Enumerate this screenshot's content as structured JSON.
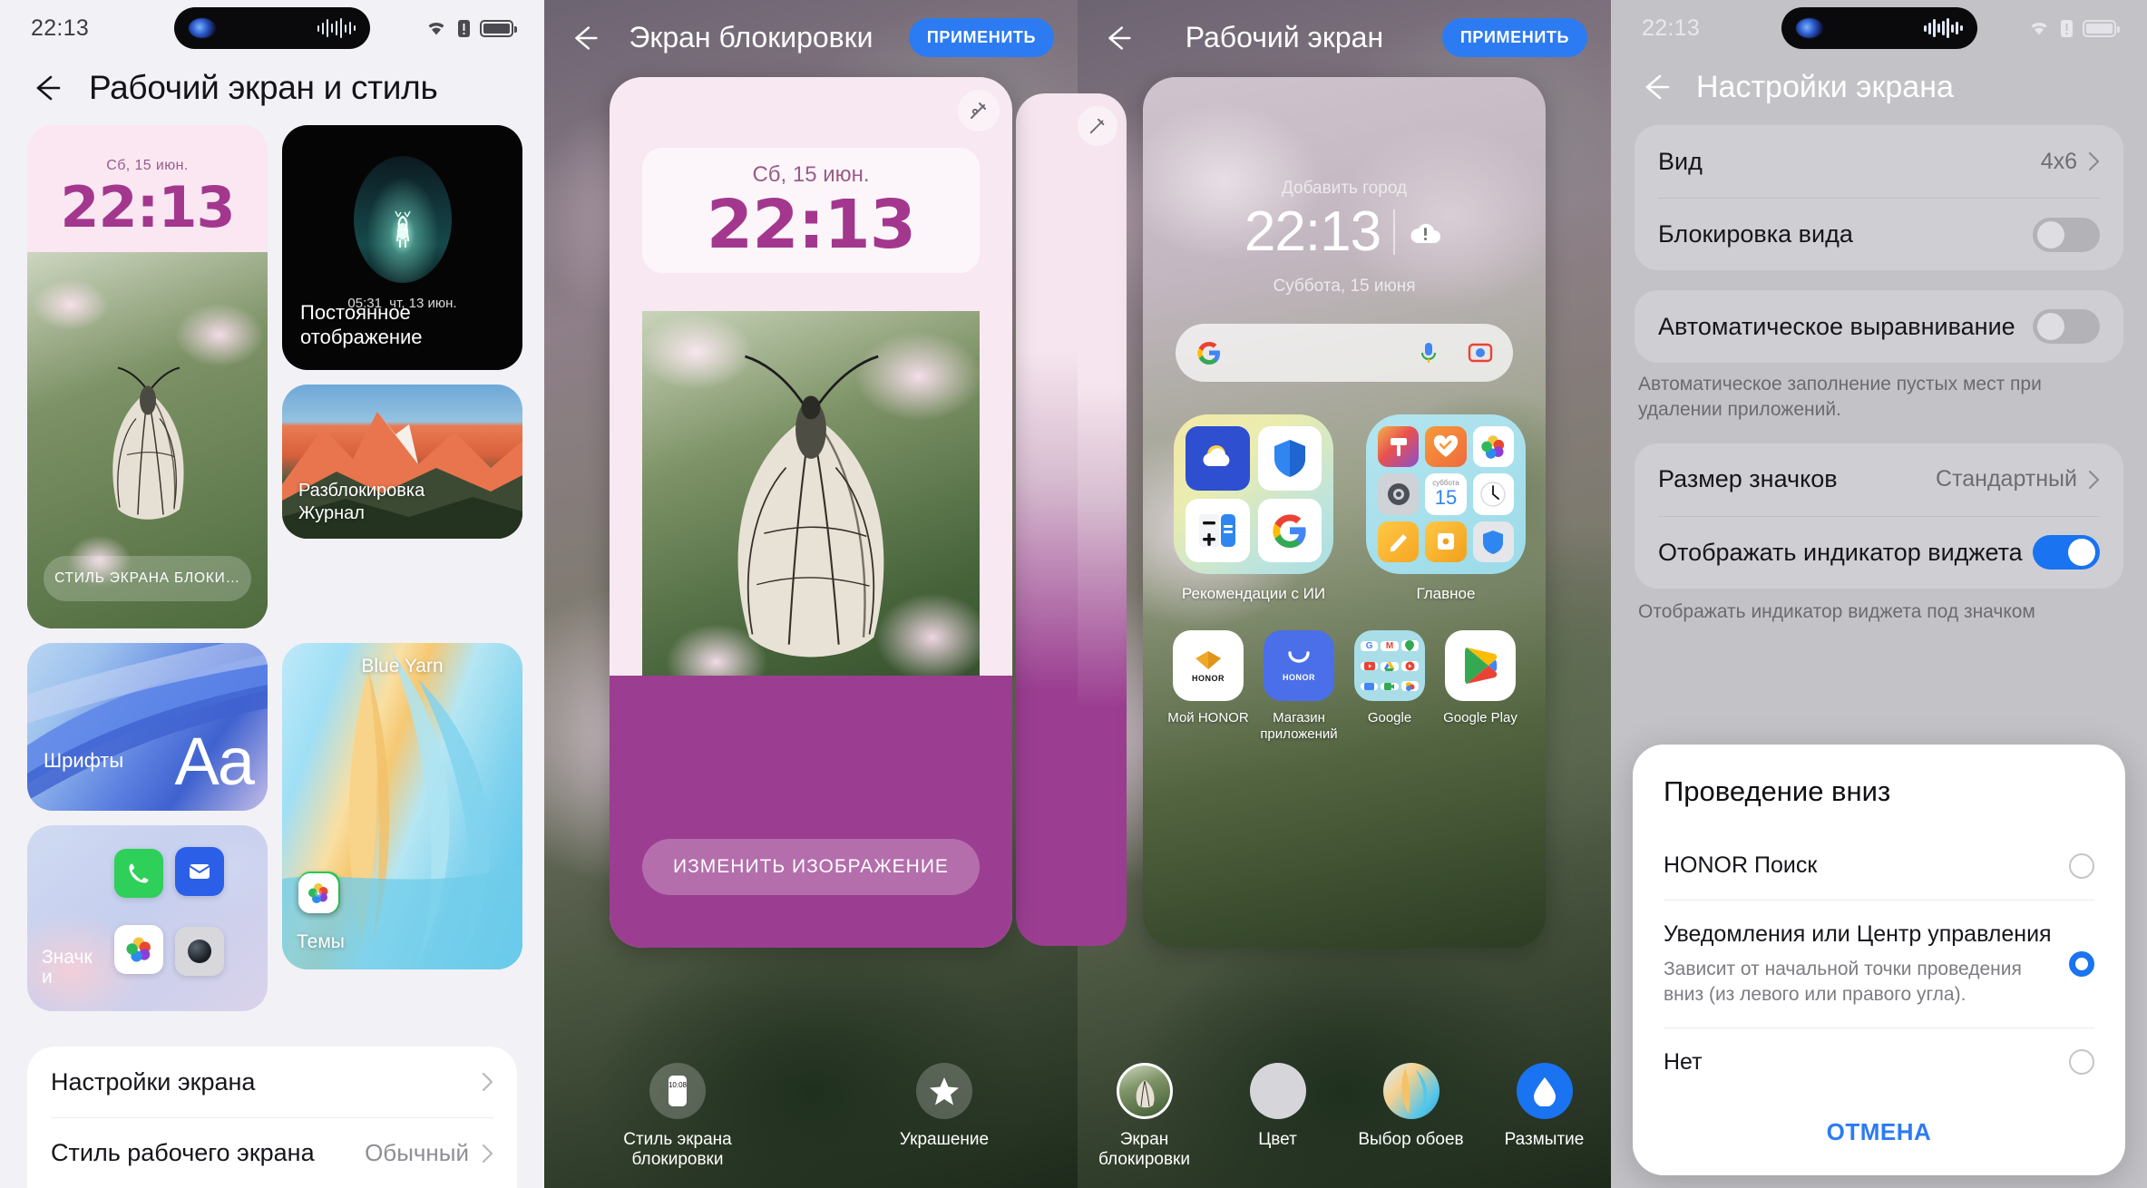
{
  "panel1": {
    "status": {
      "time": "22:13"
    },
    "title": "Рабочий экран и стиль",
    "cards": {
      "lock": {
        "date": "Сб, 15 июн.",
        "time": "22:13",
        "chip": "СТИЛЬ ЭКРАНА БЛОКИ…"
      },
      "aod": {
        "time": "05:31",
        "date": "чт, 13 июн.",
        "label_line1": "Постоянное",
        "label_line2": "отображение"
      },
      "journal": {
        "label_line1": "Разблокировка",
        "label_line2": "Журнал"
      },
      "fonts": {
        "label": "Шрифты",
        "sample": "Aa"
      },
      "icons": {
        "label": "Значк\nи"
      },
      "themes": {
        "title": "Blue Yarn",
        "label": "Темы"
      }
    },
    "list": [
      {
        "label": "Настройки экрана",
        "value": ""
      },
      {
        "label": "Стиль рабочего экрана",
        "value": "Обычный"
      }
    ]
  },
  "panel2": {
    "title": "Экран блокировки",
    "apply": "ПРИМЕНИТЬ",
    "preview": {
      "date": "Сб, 15 июн.",
      "time": "22:13",
      "button": "ИЗМЕНИТЬ ИЗОБРАЖЕНИЕ"
    },
    "toolbar": [
      {
        "label": "Стиль экрана блокировки",
        "icon": "phone-clock-icon"
      },
      {
        "label": "Украшение",
        "icon": "star-icon"
      }
    ]
  },
  "panel3": {
    "title": "Рабочий экран",
    "apply": "ПРИМЕНИТЬ",
    "home": {
      "add_city": "Добавить город",
      "time": "22:13",
      "date": "Суббота, 15 июня",
      "search_placeholder": "",
      "folders": [
        {
          "label": "Рекомендации с ИИ"
        },
        {
          "label": "Главное"
        }
      ],
      "apps": [
        {
          "label": "Мой HONOR"
        },
        {
          "label": "Магазин приложений"
        },
        {
          "label": "Google"
        },
        {
          "label": "Google Play"
        }
      ],
      "calendar_widget": {
        "weekday": "суббота",
        "day": "15"
      }
    },
    "toolbar": [
      {
        "label": "Экран блокировки",
        "icon": "wallpaper-thumb-icon"
      },
      {
        "label": "Цвет",
        "icon": "color-circle-icon"
      },
      {
        "label": "Выбор обоев",
        "icon": "wallpaper-picker-icon"
      },
      {
        "label": "Размытие",
        "icon": "blur-drop-icon"
      }
    ]
  },
  "panel4": {
    "status": {
      "time": "22:13"
    },
    "title": "Настройки экрана",
    "group1": [
      {
        "label": "Вид",
        "value": "4x6",
        "type": "link"
      },
      {
        "label": "Блокировка вида",
        "type": "toggle",
        "on": false
      }
    ],
    "group2": [
      {
        "label": "Автоматическое выравнивание",
        "type": "toggle",
        "on": false
      }
    ],
    "hint1": "Автоматическое заполнение пустых мест при удалении приложений.",
    "group3": [
      {
        "label": "Размер значков",
        "value": "Стандартный",
        "type": "link"
      },
      {
        "label": "Отображать индикатор виджета",
        "type": "toggle",
        "on": true
      }
    ],
    "hint2": "Отображать индикатор виджета под значком",
    "dialog": {
      "title": "Проведение вниз",
      "options": [
        {
          "label": "HONOR Поиск",
          "sub": "",
          "selected": false
        },
        {
          "label": "Уведомления или Центр управления",
          "sub": "Зависит от начальной точки проведения вниз (из левого или правого угла).",
          "selected": true
        },
        {
          "label": "Нет",
          "sub": "",
          "selected": false
        }
      ],
      "cancel": "ОТМЕНА"
    }
  },
  "colors": {
    "accent": "#2c7bf2",
    "toggle_on": "#1a73f0",
    "purple": "#9b3e91",
    "magenta": "#a3378e"
  }
}
